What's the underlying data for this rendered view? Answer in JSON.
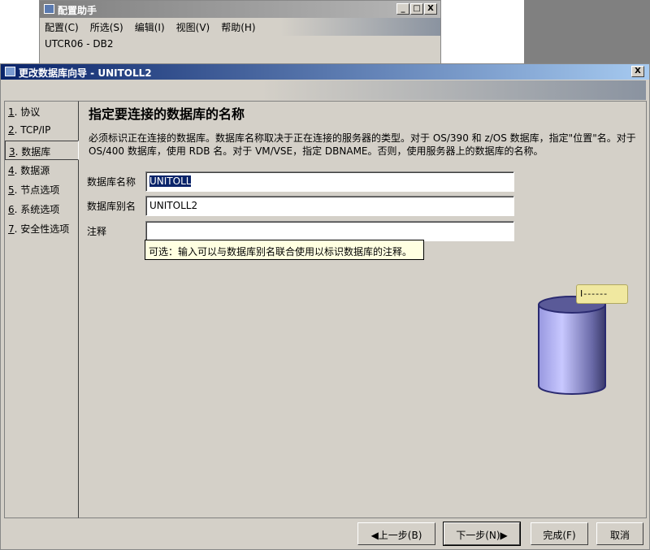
{
  "bg_window": {
    "title": "配置助手",
    "menu": [
      "配置(C)",
      "所选(S)",
      "编辑(I)",
      "视图(V)",
      "帮助(H)"
    ],
    "subtitle": "UTCR06 - DB2",
    "minimize": "_",
    "maximize": "□",
    "close": "X"
  },
  "wizard": {
    "title": "更改数据库向导 - UNITOLL2",
    "close": "X",
    "nav": [
      {
        "num": "1",
        "label": ". 协议"
      },
      {
        "num": "2",
        "label": ". TCP/IP"
      },
      {
        "num": "3",
        "label": ". 数据库"
      },
      {
        "num": "4",
        "label": ". 数据源"
      },
      {
        "num": "5",
        "label": ". 节点选项"
      },
      {
        "num": "6",
        "label": ". 系统选项"
      },
      {
        "num": "7",
        "label": ". 安全性选项"
      }
    ],
    "heading": "指定要连接的数据库的名称",
    "description": "必须标识正在连接的数据库。数据库名称取决于正在连接的服务器的类型。对于 OS/390 和 z/OS 数据库，指定\"位置\"名。对于 OS/400 数据库，使用 RDB 名。对于 VM/VSE，指定 DBNAME。否则，使用服务器上的数据库的名称。",
    "fields": {
      "db_name_label": "数据库名称",
      "db_name_value": "UNITOLL",
      "alias_label": "数据库别名",
      "alias_value": "UNITOLL2",
      "comment_label": "注释",
      "comment_value": ""
    },
    "tooltip": "可选：输入可以与数据库别名联合使用以标识数据库的注释。",
    "db_tag": "I------",
    "buttons": {
      "back": "◀上一步(B)",
      "next": "下一步(N)▶",
      "finish": "完成(F)",
      "cancel": "取消"
    }
  }
}
